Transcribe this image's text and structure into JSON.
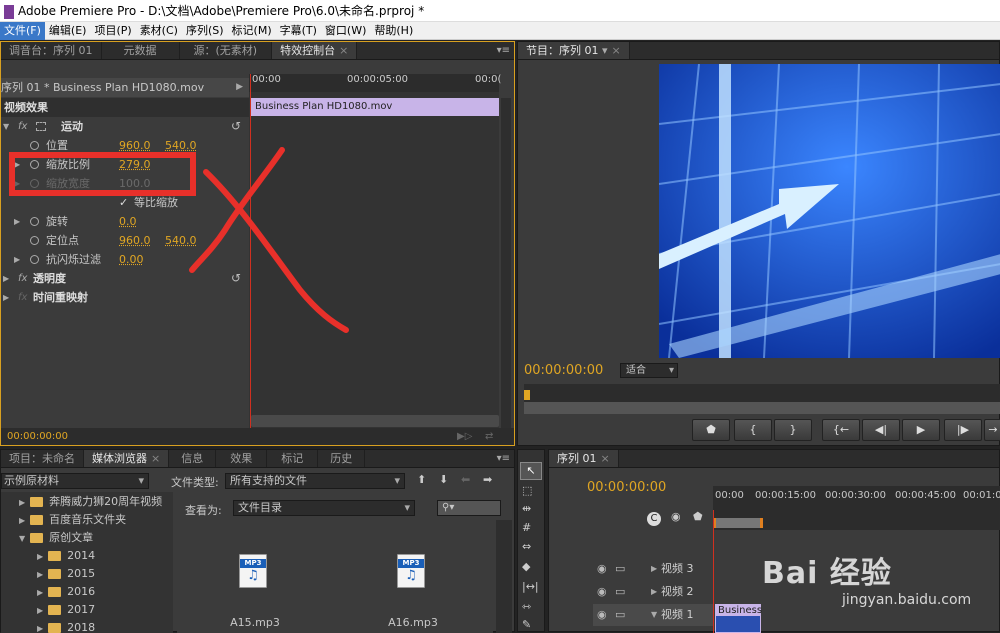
{
  "window": {
    "title": "Adobe Premiere Pro - D:\\文档\\Adobe\\Premiere Pro\\6.0\\未命名.prproj *"
  },
  "menu": [
    "文件(F)",
    "编辑(E)",
    "项目(P)",
    "素材(C)",
    "序列(S)",
    "标记(M)",
    "字幕(T)",
    "窗口(W)",
    "帮助(H)"
  ],
  "top_left_panel": {
    "tabs": [
      "调音台：序列 01",
      "元数据",
      "源：(无素材)",
      "特效控制台"
    ],
    "sequence_label": "序列 01 * Business Plan HD1080.mov",
    "ruler": {
      "t0": "00:00",
      "t1": "00:00:05:00",
      "t2": "00:0("
    },
    "clip_name": "Business Plan HD1080.mov",
    "section": "视频效果",
    "effects": {
      "motion": "运动",
      "position": {
        "label": "位置",
        "x": "960.0",
        "y": "540.0"
      },
      "scale": {
        "label": "缩放比例",
        "value": "279.0"
      },
      "scale_width": {
        "label": "缩放宽度",
        "value": "100.0"
      },
      "uniform_scale": "等比缩放",
      "rotation": {
        "label": "旋转",
        "value": "0.0"
      },
      "anchor": {
        "label": "定位点",
        "x": "960.0",
        "y": "540.0"
      },
      "antiflicker": {
        "label": "抗闪烁过滤",
        "value": "0.00"
      },
      "opacity": "透明度",
      "time_remap": "时间重映射"
    },
    "fx": "fx",
    "timecode": "00:00:00:00"
  },
  "program_monitor": {
    "tab": "节目：序列 01",
    "timecode": "00:00:00:00",
    "fit": "适合",
    "buttons": [
      "marker-icon",
      "in-icon",
      "out-icon",
      "go-in-icon",
      "step-back-icon",
      "play-icon",
      "step-forward-icon",
      "go-out-icon"
    ]
  },
  "project_panel": {
    "tabs": [
      "项目：未命名",
      "媒体浏览器",
      "信息",
      "效果",
      "标记",
      "历史"
    ],
    "location": "示例原材料",
    "file_type_label": "文件类型:",
    "file_type_value": "所有支持的文件",
    "view_as_label": "查看为:",
    "view_as_value": "文件目录",
    "tree": [
      "奔腾威力狮20周年视频",
      "百度音乐文件夹",
      "原创文章",
      "2014",
      "2015",
      "2016",
      "2017",
      "2018"
    ],
    "files": [
      {
        "name": "A15.mp3",
        "badge": "MP3"
      },
      {
        "name": "A16.mp3",
        "badge": "MP3"
      }
    ]
  },
  "timeline": {
    "tab": "序列 01",
    "timecode": "00:00:00:00",
    "ruler": [
      "00:00",
      "00:00:15:00",
      "00:00:30:00",
      "00:00:45:00",
      "00:01:0"
    ],
    "tracks": [
      "视频 3",
      "视频 2",
      "视频 1"
    ],
    "clip": "Business"
  },
  "watermark": {
    "brand": "Bai 经验",
    "url": "jingyan.baidu.com"
  },
  "colors": {
    "accent": "#e0a623",
    "annotation": "#e8302a",
    "clip": "#c8b4e8"
  }
}
